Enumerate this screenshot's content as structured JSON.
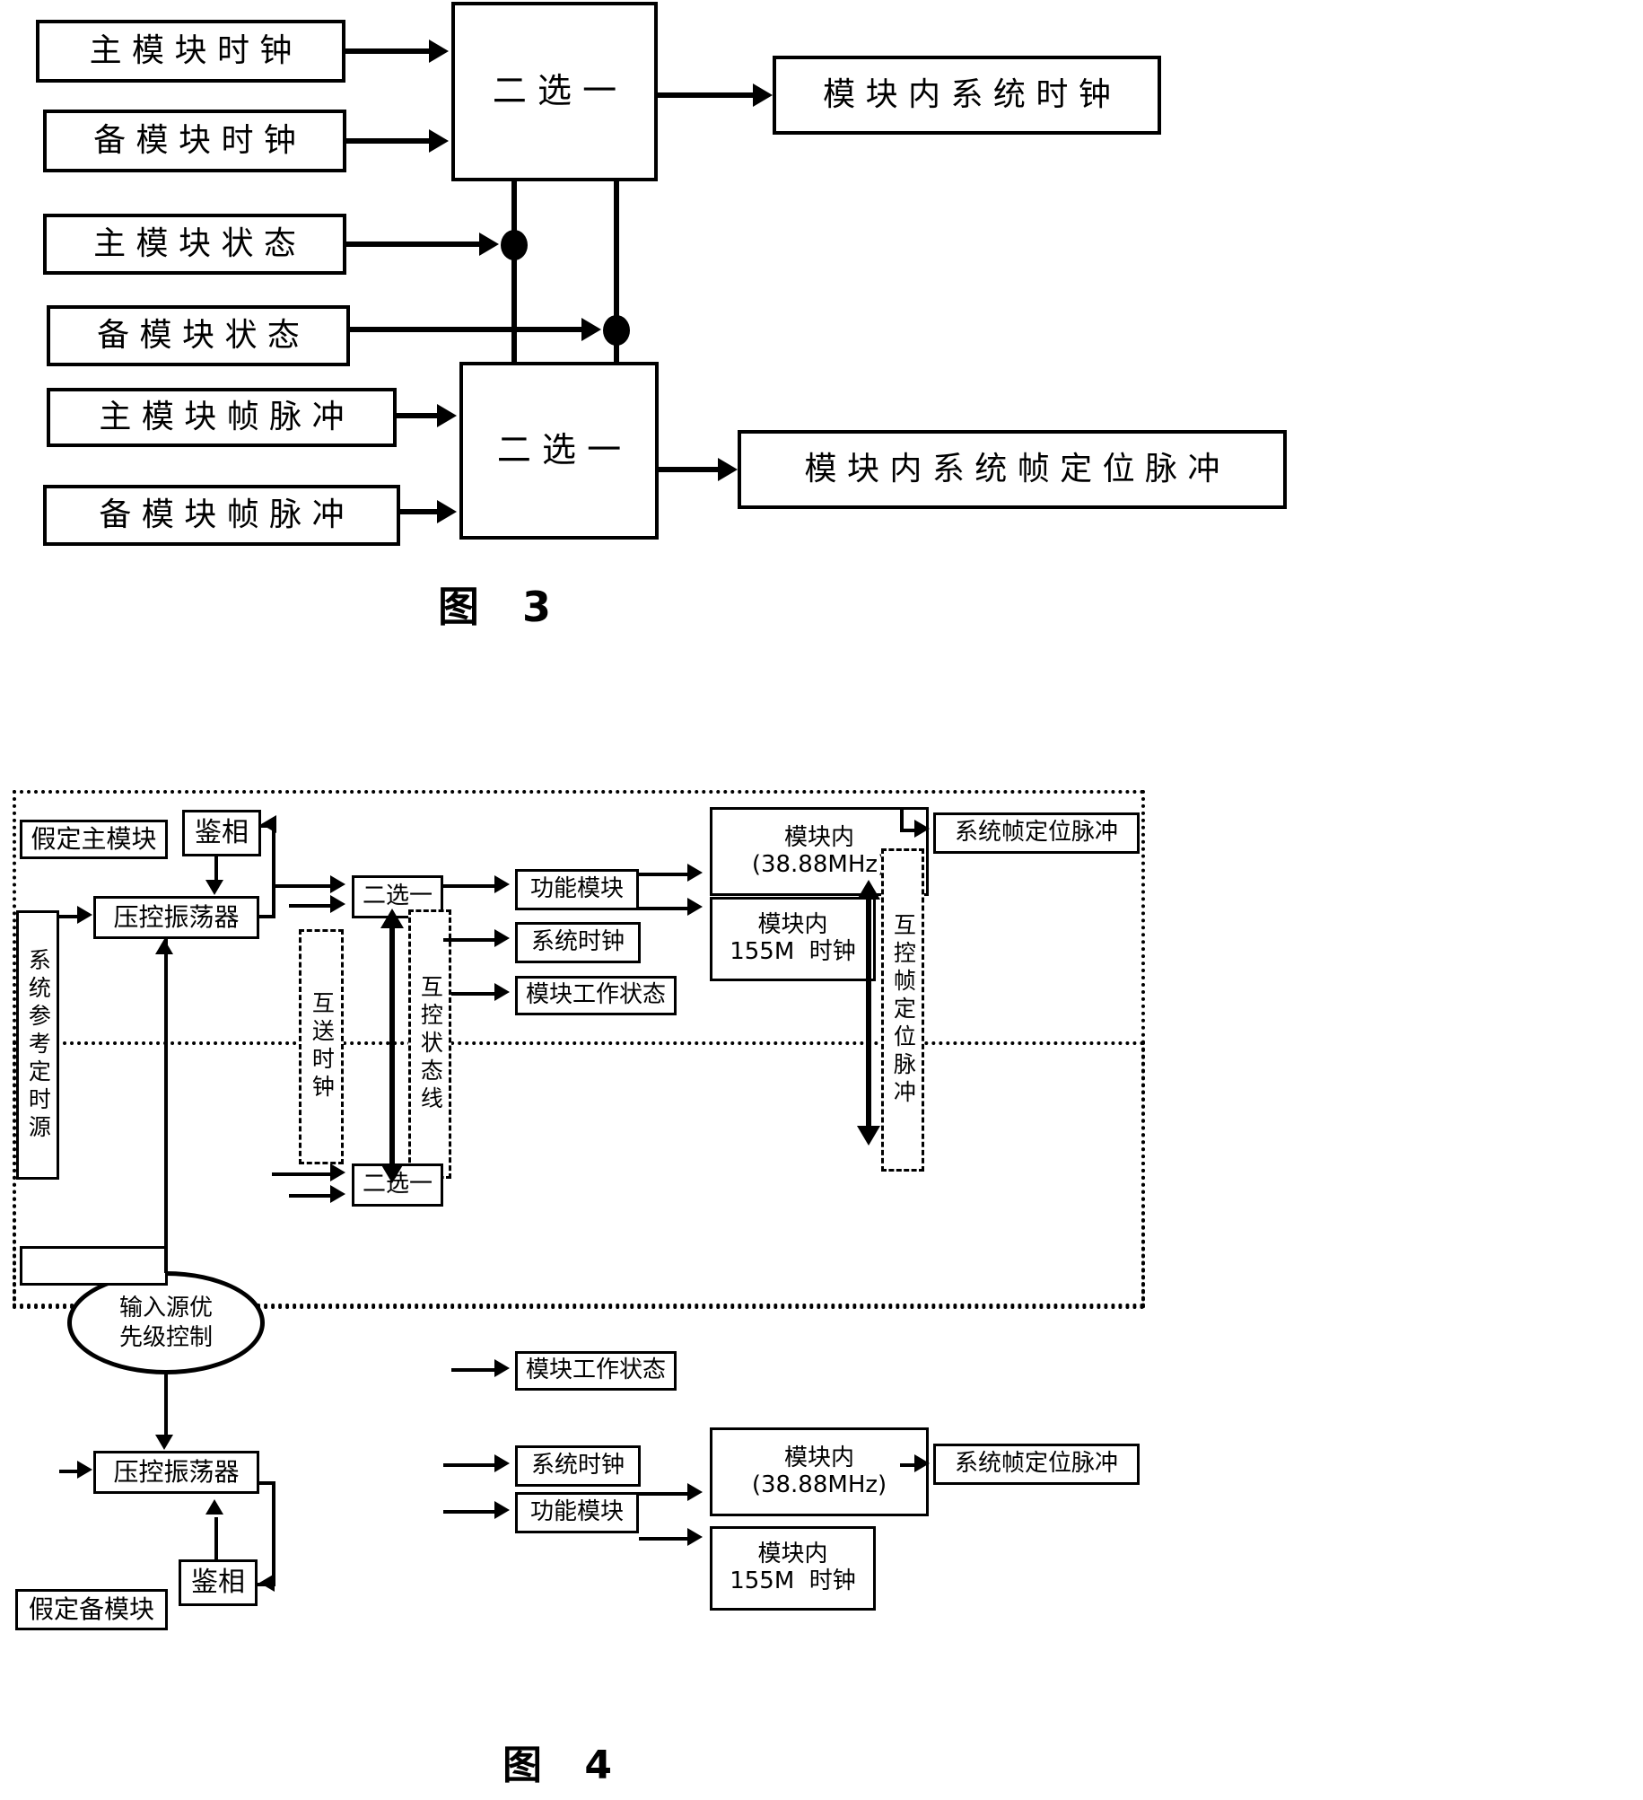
{
  "figure3": {
    "caption": "图  3",
    "inputs": [
      {
        "label": "主 模 块 时 钟"
      },
      {
        "label": "备 模 块 时 钟"
      },
      {
        "label": "主 模 块 状 态"
      },
      {
        "label": "备 模 块 状 态"
      },
      {
        "label": "主 模 块 帧 脉 冲"
      },
      {
        "label": "备 模 块 帧 脉 冲"
      }
    ],
    "selector_top": "二 选 一",
    "selector_bottom": "二 选 一",
    "output_top": "模 块 内 系 统 时 钟",
    "output_bottom": "模 块 内 系 统 帧 定 位 脉 冲"
  },
  "figure4": {
    "caption": "图 4",
    "system_ref_source": "系统参考定时源",
    "priority_control": {
      "line1": "输入源优",
      "line2": "先级控制"
    },
    "mutual_clock": "互送时钟",
    "mutual_state_line": "互控状态线",
    "mutual_frame_pulse": "互控帧定位脉冲",
    "top_module": {
      "assumed_label": "假定主模块",
      "phase_detector": "鉴相",
      "vco": "压控振荡器",
      "selector": "二选一",
      "function_module": "功能模块",
      "system_clock": "系统时钟",
      "module_status": "模块工作状态",
      "inner_38m_line1": "模块内",
      "inner_38m_line2": "(38.88MHz)",
      "inner_155m_line1": "模块内",
      "inner_155m_line2": "155M  时钟",
      "frame_pulse_out": "系统帧定位脉冲"
    },
    "bottom_module": {
      "assumed_label": "假定备模块",
      "phase_detector": "鉴相",
      "vco": "压控振荡器",
      "selector": "二选一",
      "function_module": "功能模块",
      "system_clock": "系统时钟",
      "module_status": "模块工作状态",
      "inner_38m_line1": "模块内",
      "inner_38m_line2": "(38.88MHz)",
      "inner_155m_line1": "模块内",
      "inner_155m_line2": "155M  时钟",
      "frame_pulse_out": "系统帧定位脉冲"
    }
  }
}
